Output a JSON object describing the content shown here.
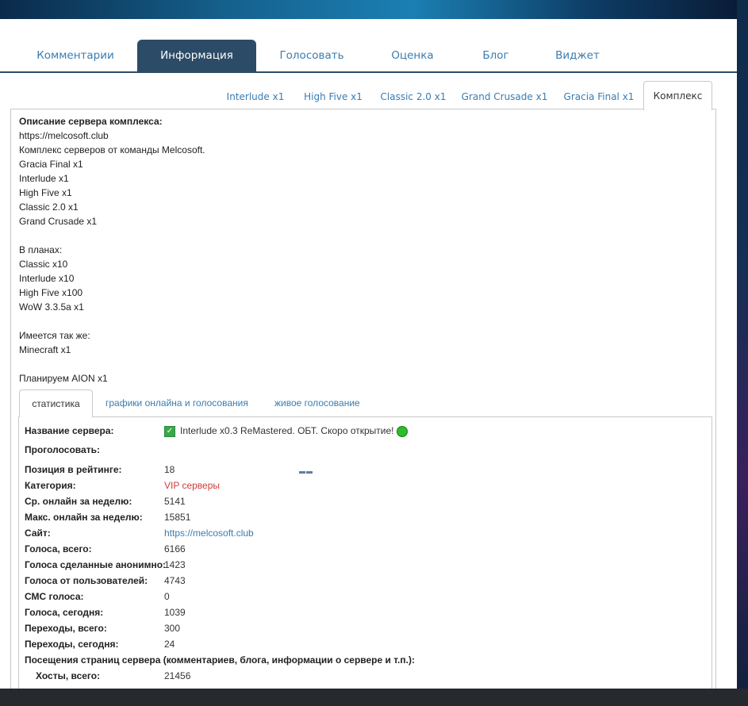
{
  "main_tabs": [
    {
      "label": "Комментарии",
      "active": false
    },
    {
      "label": "Информация",
      "active": true
    },
    {
      "label": "Голосовать",
      "active": false
    },
    {
      "label": "Оценка",
      "active": false
    },
    {
      "label": "Блог",
      "active": false
    },
    {
      "label": "Виджет",
      "active": false
    }
  ],
  "sub_tabs": [
    {
      "label": "Interlude x1"
    },
    {
      "label": "High Five x1"
    },
    {
      "label": "Classic 2.0 x1"
    },
    {
      "label": "Grand Crusade x1"
    },
    {
      "label": "Gracia Final x1"
    },
    {
      "label": "Комплекс",
      "active": true
    }
  ],
  "description": {
    "title": "Описание сервера комплекса:",
    "lines": [
      "https://melcosoft.club",
      "Комплекс серверов от команды Melcosoft.",
      "Gracia Final x1",
      "Interlude x1",
      "High Five x1",
      "Classic 2.0 x1",
      "Grand Crusade x1",
      "",
      "В планах:",
      "Classic x10",
      "Interlude x10",
      "High Five x100",
      "WoW 3.3.5a x1",
      "",
      "Имеется так же:",
      "Minecraft x1",
      "",
      "Планируем AION x1"
    ]
  },
  "stats_tabs": [
    {
      "label": "статистика",
      "active": true
    },
    {
      "label": "графики онлайна и голосования"
    },
    {
      "label": "живое голосование"
    }
  ],
  "stats": {
    "server_name_label": "Название сервера:",
    "server_name_value": "Interlude x0.3 ReMastered. ОБТ. Скоро открытие!",
    "vote_label": "Проголосовать:",
    "rows": [
      {
        "label": "Позиция в рейтинге:",
        "value": "18"
      },
      {
        "label": "Категория:",
        "value": "VIP серверы"
      },
      {
        "label": "Ср. онлайн за неделю:",
        "value": "5141"
      },
      {
        "label": "Макс. онлайн за неделю:",
        "value": "15851"
      },
      {
        "label": "Сайт:",
        "value": "https://melcosoft.club"
      },
      {
        "label": "Голоса, всего:",
        "value": "6166"
      },
      {
        "label": "Голоса сделанные анонимно:",
        "value": "1423"
      },
      {
        "label": "Голоса от пользователей:",
        "value": "4743"
      },
      {
        "label": "СМС голоса:",
        "value": "0"
      },
      {
        "label": "Голоса, сегодня:",
        "value": "1039"
      },
      {
        "label": "Переходы, всего:",
        "value": "300"
      },
      {
        "label": "Переходы, сегодня:",
        "value": "24"
      }
    ],
    "visits_heading": "Посещения страниц сервера (комментариев, блога, информации о сервере и т.п.):",
    "hosts_label": "Хосты, всего:",
    "hosts_value": "21456"
  },
  "colors": {
    "tab_active_bg": "#2c4b66",
    "link": "#3a7cb0",
    "category_red": "#d23a3a",
    "online_green": "#2cbe2c"
  }
}
